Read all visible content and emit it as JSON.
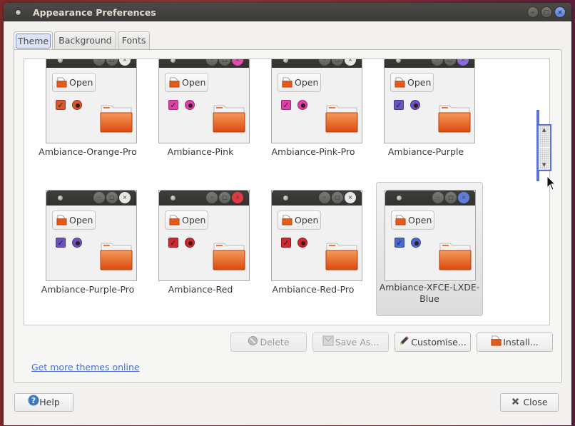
{
  "window": {
    "title": "Appearance Preferences",
    "controls": {
      "minimize": "–",
      "maximize": "□",
      "close": "×"
    }
  },
  "tabs": [
    {
      "label": "Theme",
      "active": true
    },
    {
      "label": "Background",
      "active": false
    },
    {
      "label": "Fonts",
      "active": false
    }
  ],
  "themes": [
    {
      "name": "Ambiance-Orange-Pro",
      "accent": "#d9572c",
      "close_color": "#e8e8e8",
      "selected": false
    },
    {
      "name": "Ambiance-Pink",
      "accent": "#e03fa8",
      "close_color": "#e648b0",
      "selected": false
    },
    {
      "name": "Ambiance-Pink-Pro",
      "accent": "#e03fa8",
      "close_color": "#e8e8e8",
      "selected": false
    },
    {
      "name": "Ambiance-Purple",
      "accent": "#6a52c4",
      "close_color": "#8a6ae0",
      "selected": false
    },
    {
      "name": "Ambiance-Purple-Pro",
      "accent": "#6a52c4",
      "close_color": "#e8e8e8",
      "selected": false
    },
    {
      "name": "Ambiance-Red",
      "accent": "#d3262e",
      "close_color": "#e23a40",
      "selected": false
    },
    {
      "name": "Ambiance-Red-Pro",
      "accent": "#d3262e",
      "close_color": "#e8e8e8",
      "selected": false
    },
    {
      "name": "Ambiance-XFCE-LXDE-Blue",
      "name_line1": "Ambiance-XFCE-LXDE-",
      "name_line2": "Blue",
      "accent": "#4a68cf",
      "close_color": "#5f7fe0",
      "selected": true
    }
  ],
  "preview": {
    "open_label": "Open"
  },
  "actions": {
    "delete": {
      "label": "Delete",
      "enabled": false
    },
    "save_as": {
      "label": "Save As...",
      "enabled": false
    },
    "customise": {
      "label": "Customise...",
      "enabled": true
    },
    "install": {
      "label": "Install...",
      "enabled": true
    }
  },
  "link": {
    "label": "Get more themes online"
  },
  "footer": {
    "help": "Help",
    "close": "Close"
  },
  "colors": {
    "accent": "#5b74d4",
    "link": "#4a6fd6",
    "titlebar": "#3c3b37"
  }
}
